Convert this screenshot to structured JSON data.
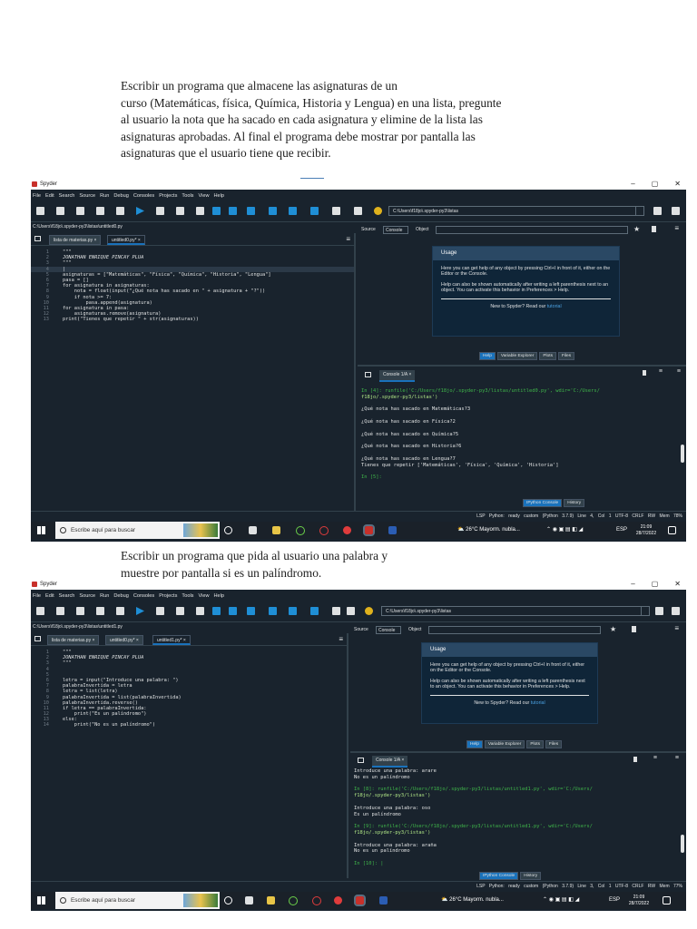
{
  "doc": {
    "para1_lines": [
      "Escribir un programa que almacene las asignaturas de un",
      "curso (Matemáticas, física, Química, Historia y Lengua) en una lista, pregunte",
      "al usuario la nota que ha sacado en cada asignatura y elimine de la lista las",
      "asignaturas aprobadas. Al final el programa debe mostrar por pantalla las",
      "asignaturas que el usuario tiene que recibir."
    ],
    "para2_lines": [
      "Escribir un programa que pida al usuario una palabra y",
      "muestre por pantalla si es un palíndromo."
    ]
  },
  "common": {
    "app_title": "Spyder",
    "win_min": "–",
    "win_max": "▢",
    "win_close": "✕",
    "menu": [
      "File",
      "Edit",
      "Search",
      "Source",
      "Run",
      "Debug",
      "Consoles",
      "Projects",
      "Tools",
      "View",
      "Help"
    ],
    "help": {
      "source_label": "Source",
      "source_value": "Console",
      "object_label": "Object",
      "usage_title": "Usage",
      "usage_p1": "Here you can get help of any object by pressing Ctrl+I in front of it, either on the Editor or the Console.",
      "usage_p2": "Help can also be shown automatically after writing a left parenthesis next to an object. You can activate this behavior in Preferences > Help.",
      "new_to": "New to Spyder? Read our",
      "tutorial": "tutorial",
      "tabs": [
        "Help",
        "Variable Explorer",
        "Plots",
        "Files"
      ]
    },
    "console_tab": "Console 1/A ×",
    "console_tabs": [
      "IPython Console",
      "History"
    ],
    "taskbar": {
      "search": "Escribe aquí para buscar",
      "weather": "26°C  Mayorm. nubla...",
      "lang": "ESP",
      "time": "21:09",
      "date": "28/7/2022"
    }
  },
  "shot1": {
    "path": "C:\\Users\\f18jo\\.spyder-py3\\listas",
    "file_path": "C:\\Users\\f18jo\\.spyder-py3\\listas\\untitled0.py",
    "tabs": [
      "lista de materias.py ×",
      "untitled0.py* ×"
    ],
    "code": [
      {
        "n": "1",
        "t": "\"\"\"",
        "cls": "c"
      },
      {
        "n": "2",
        "t": "JONATHAN ENRIQUE PINCAY PLUA",
        "cls": "c"
      },
      {
        "n": "3",
        "t": "\"\"\"",
        "cls": "c"
      },
      {
        "n": "4",
        "t": "|",
        "cls": ""
      },
      {
        "n": "5",
        "t": "asignaturas = [\"Matemáticas\", \"Física\", \"Química\", \"Historia\", \"Lengua\"]",
        "cls": ""
      },
      {
        "n": "6",
        "t": "pasa = []",
        "cls": ""
      },
      {
        "n": "7",
        "t": "for asignatura in asignaturas:",
        "cls": ""
      },
      {
        "n": "8",
        "t": "    nota = float(input(\"¿Qué nota has sacado en \" + asignatura + \"?\"))",
        "cls": ""
      },
      {
        "n": "9",
        "t": "    if nota >= 7:",
        "cls": ""
      },
      {
        "n": "10",
        "t": "        pasa.append(asignatura)",
        "cls": ""
      },
      {
        "n": "11",
        "t": "for asignatura in pasa:",
        "cls": ""
      },
      {
        "n": "12",
        "t": "    asignaturas.remove(asignatura)",
        "cls": ""
      },
      {
        "n": "13",
        "t": "print(\"Tienes que repetir \" + str(asignaturas))",
        "cls": ""
      }
    ],
    "console": [
      {
        "t": "In [4]: runfile('C:/Users/f18jo/.spyder-py3/listas/untitled0.py', wdir='C:/Users/",
        "cls": "p"
      },
      {
        "t": "f18jo/.spyder-py3/listas')",
        "cls": "g"
      },
      {
        "t": "",
        "cls": ""
      },
      {
        "t": "¿Qué nota has sacado en Matemáticas?3",
        "cls": ""
      },
      {
        "t": "",
        "cls": ""
      },
      {
        "t": "¿Qué nota has sacado en Física?2",
        "cls": ""
      },
      {
        "t": "",
        "cls": ""
      },
      {
        "t": "¿Qué nota has sacado en Química?5",
        "cls": ""
      },
      {
        "t": "",
        "cls": ""
      },
      {
        "t": "¿Qué nota has sacado en Historia?6",
        "cls": ""
      },
      {
        "t": "",
        "cls": ""
      },
      {
        "t": "¿Qué nota has sacado en Lengua?7",
        "cls": ""
      },
      {
        "t": "Tienes que repetir ['Matemáticas', 'Física', 'Química', 'Historia']",
        "cls": ""
      },
      {
        "t": "",
        "cls": ""
      },
      {
        "t": "In [5]:",
        "cls": "p"
      }
    ],
    "status": "LSP Python: ready   custom (Python 3.7.9)   Line 4, Col 1   UTF-8   CRLF   RW   Mem 78%"
  },
  "shot2": {
    "path": "C:\\Users\\f18jo\\.spyder-py3\\listas",
    "file_path": "C:\\Users\\f18jo\\.spyder-py3\\listas\\untitled1.py",
    "tabs": [
      "lista de materias.py ×",
      "untitled0.py* ×",
      "untitled1.py* ×"
    ],
    "code": [
      {
        "n": "1",
        "t": "\"\"\"",
        "cls": "c"
      },
      {
        "n": "2",
        "t": "JONATHAN ENRIQUE PINCAY PLUA",
        "cls": "c"
      },
      {
        "n": "3",
        "t": "\"\"\"",
        "cls": "c"
      },
      {
        "n": "4",
        "t": "",
        "cls": ""
      },
      {
        "n": "5",
        "t": "",
        "cls": ""
      },
      {
        "n": "6",
        "t": "letra = input(\"Introduce una palabra: \")",
        "cls": ""
      },
      {
        "n": "7",
        "t": "palabraInvertida = letra",
        "cls": ""
      },
      {
        "n": "8",
        "t": "letra = list(letra)",
        "cls": ""
      },
      {
        "n": "9",
        "t": "palabraInvertida = list(palabraInvertida)",
        "cls": ""
      },
      {
        "n": "10",
        "t": "palabraInvertida.reverse()",
        "cls": ""
      },
      {
        "n": "11",
        "t": "if letra == palabraInvertida:",
        "cls": ""
      },
      {
        "n": "12",
        "t": "    print(\"Es un palíndromo\")",
        "cls": ""
      },
      {
        "n": "13",
        "t": "else:",
        "cls": ""
      },
      {
        "n": "14",
        "t": "    print(\"No es un palíndromo\")",
        "cls": ""
      }
    ],
    "console": [
      {
        "t": "Introduce una palabra: arare",
        "cls": ""
      },
      {
        "t": "No es un palíndromo",
        "cls": ""
      },
      {
        "t": "",
        "cls": ""
      },
      {
        "t": "In [8]: runfile('C:/Users/f18jo/.spyder-py3/listas/untitled1.py', wdir='C:/Users/",
        "cls": "p"
      },
      {
        "t": "f18jo/.spyder-py3/listas')",
        "cls": "g"
      },
      {
        "t": "",
        "cls": ""
      },
      {
        "t": "Introduce una palabra: oso",
        "cls": ""
      },
      {
        "t": "Es un palíndromo",
        "cls": ""
      },
      {
        "t": "",
        "cls": ""
      },
      {
        "t": "In [9]: runfile('C:/Users/f18jo/.spyder-py3/listas/untitled1.py', wdir='C:/Users/",
        "cls": "p"
      },
      {
        "t": "f18jo/.spyder-py3/listas')",
        "cls": "g"
      },
      {
        "t": "",
        "cls": ""
      },
      {
        "t": "Introduce una palabra: araña",
        "cls": ""
      },
      {
        "t": "No es un palíndromo",
        "cls": ""
      },
      {
        "t": "",
        "cls": ""
      },
      {
        "t": "In [10]: |",
        "cls": "p"
      }
    ],
    "status": "LSP Python: ready   custom (Python 3.7.9)   Line 3, Col 1   UTF-8   CRLF   RW   Mem 77%"
  },
  "colors": {
    "ide_bg": "#19232d",
    "accent": "#1a72bb",
    "prompt": "#3fb54a",
    "docstring": "#e8d35a",
    "taskbar": "#1a2129"
  }
}
